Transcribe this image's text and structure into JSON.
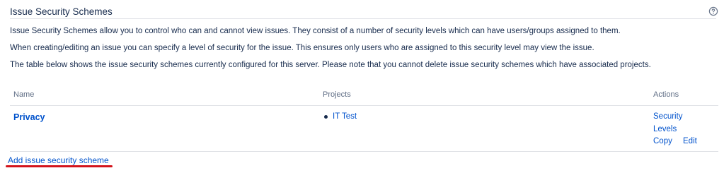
{
  "header": {
    "title": "Issue Security Schemes",
    "help_icon": "help-icon"
  },
  "description": [
    "Issue Security Schemes allow you to control who can and cannot view issues. They consist of a number of security levels which can have users/groups assigned to them.",
    "When creating/editing an issue you can specify a level of security for the issue. This ensures only users who are assigned to this security level may view the issue.",
    "The table below shows the issue security schemes currently configured for this server. Please note that you cannot delete issue security schemes which have associated projects."
  ],
  "table": {
    "headers": {
      "name": "Name",
      "projects": "Projects",
      "actions": "Actions"
    },
    "rows": [
      {
        "name": "Privacy",
        "projects": [
          "IT Test"
        ],
        "actions": {
          "security": "Security",
          "levels": "Levels",
          "copy": "Copy",
          "edit": "Edit"
        }
      }
    ]
  },
  "add_link": "Add issue security scheme",
  "colors": {
    "link": "#0052cc",
    "text": "#172b4d",
    "muted": "#5e6c84",
    "annotation": "#d3131b"
  }
}
